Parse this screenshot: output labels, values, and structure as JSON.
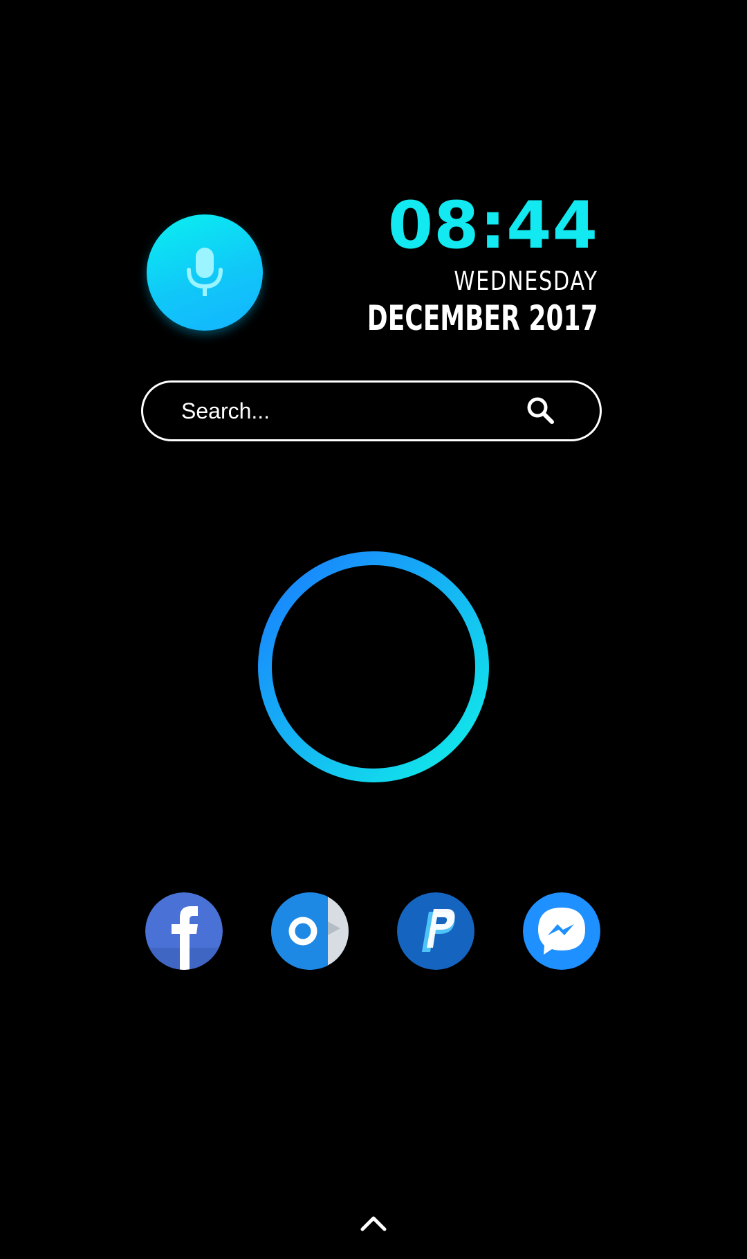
{
  "widget": {
    "time": "08:44",
    "weekday": "WEDNESDAY",
    "date": "DECEMBER 2017"
  },
  "search": {
    "placeholder": "Search..."
  },
  "icons": {
    "mic": "microphone-icon",
    "search": "search-icon",
    "ring": "circle-ring-icon",
    "drawer": "chevron-up-icon"
  },
  "dock": {
    "apps": [
      {
        "name": "Facebook",
        "icon": "facebook-icon",
        "color": "#4a72d6"
      },
      {
        "name": "Outlook",
        "icon": "outlook-icon",
        "color": "#1e88e5"
      },
      {
        "name": "PayPal",
        "icon": "paypal-icon",
        "color": "#1565c0"
      },
      {
        "name": "Messenger",
        "icon": "messenger-icon",
        "color": "#1e90ff"
      }
    ]
  },
  "colors": {
    "background": "#000000",
    "accent": "#12e9f0",
    "ring_start": "#1a7dff",
    "ring_end": "#10f0e8"
  }
}
